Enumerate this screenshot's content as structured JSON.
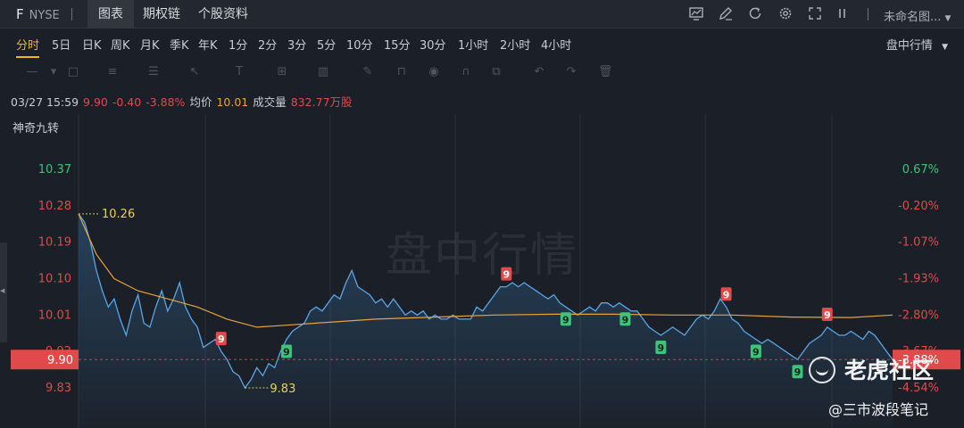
{
  "header": {
    "ticker": "F",
    "exchange": "NYSE",
    "tabs": [
      {
        "label": "图表",
        "active": true
      },
      {
        "label": "期权链",
        "active": false
      },
      {
        "label": "个股资料",
        "active": false
      }
    ],
    "layout_name": "未命名图...",
    "icons": [
      "chart-layout-icon",
      "edit-icon",
      "refresh-icon",
      "settings-icon",
      "fullscreen-icon",
      "more-icon"
    ]
  },
  "periods": {
    "items": [
      "分时",
      "5日",
      "日K",
      "周K",
      "月K",
      "季K",
      "年K",
      "1分",
      "2分",
      "3分",
      "5分",
      "10分",
      "15分",
      "30分",
      "1小时",
      "2小时",
      "4小时"
    ],
    "active": "分时",
    "mode": "盘中行情"
  },
  "info": {
    "datetime": "03/27 15:59",
    "price": "9.90",
    "change": "-0.40",
    "change_pct": "-3.88%",
    "avg_label": "均价",
    "avg_value": "10.01",
    "volume_label": "成交量",
    "volume_value": "832.77万股"
  },
  "indicator_label": "神奇九转",
  "watermark": "盘中行情",
  "brand": {
    "name": "老虎社区",
    "author": "@三市波段笔记"
  },
  "colors": {
    "accent": "#f0b90b",
    "down": "#e04a4a",
    "up": "#3fc27a",
    "avg_line": "#e8a33a",
    "price_line": "#5aa6e6"
  },
  "chart_data": {
    "type": "line",
    "y_left_ticks": [
      "10.37",
      "10.28",
      "10.19",
      "10.10",
      "10.01",
      "9.92",
      "9.83"
    ],
    "y_right_ticks": [
      "0.67%",
      "-0.20%",
      "-1.07%",
      "-1.93%",
      "-2.80%",
      "-3.67%",
      "-4.54%"
    ],
    "ylim": [
      9.78,
      10.42
    ],
    "prev_close": 10.3,
    "current_price": "9.90",
    "current_pct": "-3.88%",
    "high_label": "10.26",
    "low_label": "9.83",
    "high_value": 10.26,
    "low_value": 9.83,
    "price": [
      [
        0,
        10.26
      ],
      [
        2,
        10.24
      ],
      [
        4,
        10.19
      ],
      [
        6,
        10.12
      ],
      [
        8,
        10.07
      ],
      [
        10,
        10.03
      ],
      [
        12,
        10.05
      ],
      [
        14,
        10.0
      ],
      [
        16,
        9.96
      ],
      [
        18,
        10.02
      ],
      [
        20,
        10.06
      ],
      [
        22,
        9.99
      ],
      [
        24,
        9.98
      ],
      [
        26,
        10.03
      ],
      [
        28,
        10.07
      ],
      [
        30,
        10.02
      ],
      [
        32,
        10.05
      ],
      [
        34,
        10.09
      ],
      [
        36,
        10.03
      ],
      [
        38,
        10.0
      ],
      [
        40,
        9.98
      ],
      [
        42,
        9.93
      ],
      [
        44,
        9.94
      ],
      [
        46,
        9.95
      ],
      [
        48,
        9.92
      ],
      [
        50,
        9.9
      ],
      [
        52,
        9.87
      ],
      [
        54,
        9.86
      ],
      [
        56,
        9.83
      ],
      [
        58,
        9.85
      ],
      [
        60,
        9.88
      ],
      [
        62,
        9.86
      ],
      [
        64,
        9.89
      ],
      [
        66,
        9.88
      ],
      [
        68,
        9.92
      ],
      [
        70,
        9.95
      ],
      [
        72,
        9.97
      ],
      [
        74,
        9.98
      ],
      [
        76,
        9.99
      ],
      [
        78,
        10.02
      ],
      [
        80,
        10.03
      ],
      [
        82,
        10.02
      ],
      [
        84,
        10.04
      ],
      [
        86,
        10.06
      ],
      [
        88,
        10.05
      ],
      [
        90,
        10.09
      ],
      [
        92,
        10.12
      ],
      [
        94,
        10.08
      ],
      [
        96,
        10.07
      ],
      [
        98,
        10.06
      ],
      [
        100,
        10.04
      ],
      [
        102,
        10.05
      ],
      [
        104,
        10.03
      ],
      [
        106,
        10.05
      ],
      [
        108,
        10.03
      ],
      [
        110,
        10.01
      ],
      [
        112,
        10.02
      ],
      [
        114,
        10.01
      ],
      [
        116,
        10.02
      ],
      [
        118,
        10.0
      ],
      [
        120,
        10.01
      ],
      [
        122,
        10.0
      ],
      [
        124,
        10.0
      ],
      [
        126,
        10.01
      ],
      [
        128,
        10.0
      ],
      [
        130,
        10.0
      ],
      [
        132,
        10.0
      ],
      [
        134,
        10.03
      ],
      [
        136,
        10.02
      ],
      [
        138,
        10.04
      ],
      [
        140,
        10.06
      ],
      [
        142,
        10.08
      ],
      [
        144,
        10.08
      ],
      [
        146,
        10.09
      ],
      [
        148,
        10.08
      ],
      [
        150,
        10.09
      ],
      [
        152,
        10.08
      ],
      [
        154,
        10.07
      ],
      [
        156,
        10.06
      ],
      [
        158,
        10.05
      ],
      [
        160,
        10.06
      ],
      [
        162,
        10.04
      ],
      [
        164,
        10.03
      ],
      [
        166,
        10.02
      ],
      [
        168,
        10.01
      ],
      [
        170,
        10.02
      ],
      [
        172,
        10.03
      ],
      [
        174,
        10.02
      ],
      [
        176,
        10.04
      ],
      [
        178,
        10.04
      ],
      [
        180,
        10.03
      ],
      [
        182,
        10.04
      ],
      [
        184,
        10.03
      ],
      [
        186,
        10.02
      ],
      [
        188,
        10.02
      ],
      [
        190,
        10.0
      ],
      [
        192,
        9.98
      ],
      [
        194,
        9.97
      ],
      [
        196,
        9.96
      ],
      [
        198,
        9.97
      ],
      [
        200,
        9.98
      ],
      [
        202,
        9.97
      ],
      [
        204,
        9.96
      ],
      [
        206,
        9.98
      ],
      [
        208,
        10.0
      ],
      [
        210,
        10.01
      ],
      [
        212,
        10.0
      ],
      [
        214,
        10.02
      ],
      [
        216,
        10.05
      ],
      [
        218,
        10.03
      ],
      [
        220,
        10.0
      ],
      [
        222,
        9.99
      ],
      [
        224,
        9.97
      ],
      [
        226,
        9.96
      ],
      [
        228,
        9.95
      ],
      [
        230,
        9.94
      ],
      [
        232,
        9.95
      ],
      [
        234,
        9.94
      ],
      [
        236,
        9.93
      ],
      [
        238,
        9.92
      ],
      [
        240,
        9.91
      ],
      [
        242,
        9.9
      ],
      [
        244,
        9.92
      ],
      [
        246,
        9.94
      ],
      [
        248,
        9.95
      ],
      [
        250,
        9.96
      ],
      [
        252,
        9.98
      ],
      [
        254,
        9.97
      ],
      [
        256,
        9.96
      ],
      [
        258,
        9.96
      ],
      [
        260,
        9.97
      ],
      [
        262,
        9.96
      ],
      [
        264,
        9.95
      ],
      [
        266,
        9.97
      ],
      [
        268,
        9.96
      ],
      [
        270,
        9.94
      ],
      [
        272,
        9.92
      ],
      [
        274,
        9.9
      ]
    ],
    "avg": [
      [
        0,
        10.26
      ],
      [
        6,
        10.16
      ],
      [
        12,
        10.1
      ],
      [
        20,
        10.07
      ],
      [
        30,
        10.05
      ],
      [
        40,
        10.03
      ],
      [
        50,
        10.0
      ],
      [
        60,
        9.98
      ],
      [
        70,
        9.985
      ],
      [
        80,
        9.99
      ],
      [
        90,
        9.995
      ],
      [
        100,
        10.0
      ],
      [
        120,
        10.005
      ],
      [
        140,
        10.01
      ],
      [
        160,
        10.012
      ],
      [
        180,
        10.012
      ],
      [
        200,
        10.01
      ],
      [
        220,
        10.01
      ],
      [
        240,
        10.005
      ],
      [
        260,
        10.004
      ],
      [
        274,
        10.01
      ]
    ],
    "td_markers": [
      {
        "x": 48,
        "label": "9",
        "dir": "up"
      },
      {
        "x": 70,
        "label": "9",
        "dir": "down"
      },
      {
        "x": 144,
        "label": "9",
        "dir": "up"
      },
      {
        "x": 164,
        "label": "9",
        "dir": "down"
      },
      {
        "x": 184,
        "label": "9",
        "dir": "down"
      },
      {
        "x": 196,
        "label": "9",
        "dir": "down"
      },
      {
        "x": 218,
        "label": "9",
        "dir": "up"
      },
      {
        "x": 228,
        "label": "9",
        "dir": "down"
      },
      {
        "x": 242,
        "label": "9",
        "dir": "down"
      },
      {
        "x": 252,
        "label": "9",
        "dir": "up"
      }
    ]
  }
}
